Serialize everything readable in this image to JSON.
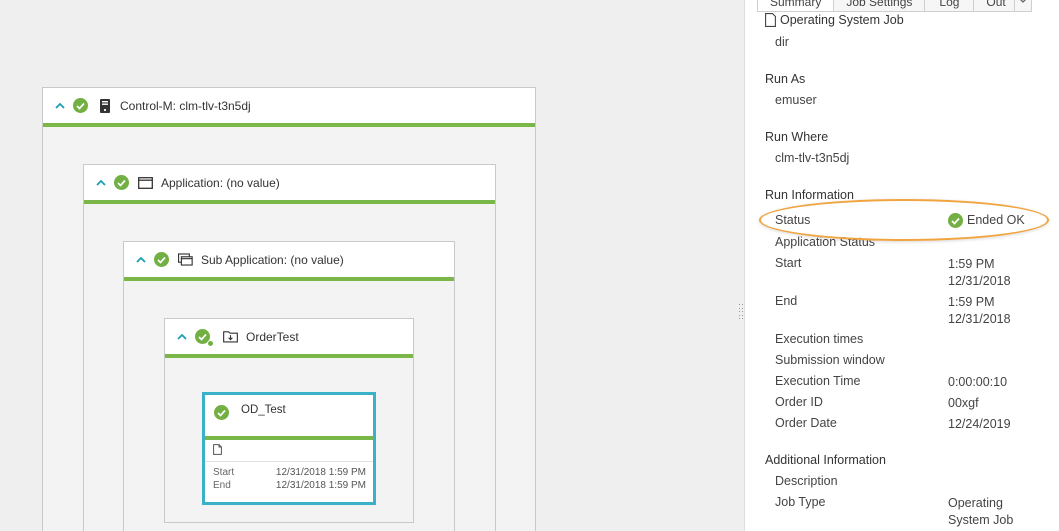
{
  "canvas": {
    "controlm": {
      "title": "Control-M: clm-tlv-t3n5dj",
      "icon": "server-icon"
    },
    "application": {
      "title": "Application: (no value)",
      "icon": "window-icon"
    },
    "sub_application": {
      "title": "Sub Application: (no value)",
      "icon": "stacked-windows-icon"
    },
    "folder": {
      "title": "OrderTest",
      "icon": "folder-download-icon"
    },
    "job": {
      "name": "OD_Test",
      "start_label": "Start",
      "start_value": "12/31/2018 1:59 PM",
      "end_label": "End",
      "end_value": "12/31/2018 1:59 PM"
    }
  },
  "panel": {
    "tabs": [
      "Summary",
      "Job Settings",
      "Log",
      "Out"
    ],
    "job_type_header": "Operating System Job",
    "command": "dir",
    "run_as_title": "Run As",
    "run_as_value": "emuser",
    "run_where_title": "Run Where",
    "run_where_value": "clm-tlv-t3n5dj",
    "run_info_title": "Run Information",
    "status_label": "Status",
    "status_value": "Ended OK",
    "app_status_label": "Application Status",
    "start_label": "Start",
    "start_time": "1:59 PM",
    "start_date": "12/31/2018",
    "end_label": "End",
    "end_time": "1:59 PM",
    "end_date": "12/31/2018",
    "execution_times_label": "Execution times",
    "submission_window_label": "Submission window",
    "execution_time_label": "Execution Time",
    "execution_time_value": "0:00:00:10",
    "order_id_label": "Order ID",
    "order_id_value": "00xgf",
    "order_date_label": "Order Date",
    "order_date_value": "12/24/2019",
    "additional_info_title": "Additional Information",
    "description_label": "Description",
    "job_type_label": "Job Type",
    "job_type_value_1": "Operating",
    "job_type_value_2": "System Job"
  },
  "colors": {
    "ok_green": "#72b043",
    "bar_green": "#7ab648",
    "job_border": "#3ab1c8",
    "caret_teal": "#1a9fb5",
    "highlight": "#f0a540"
  }
}
